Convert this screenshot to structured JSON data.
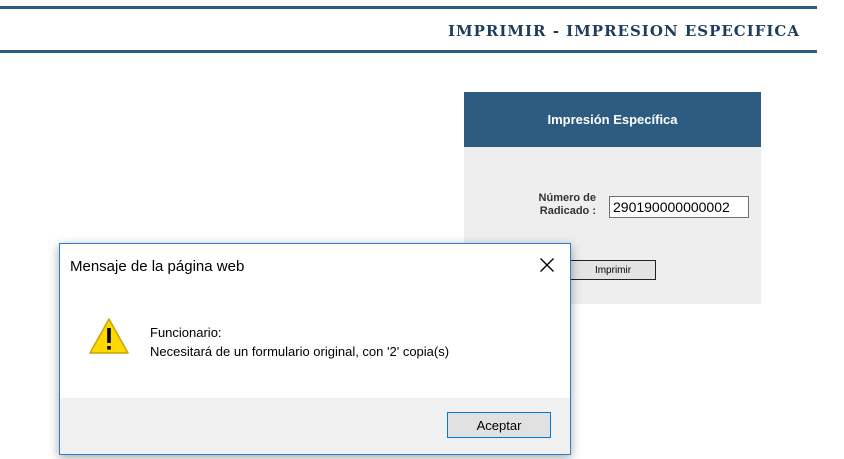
{
  "header": {
    "title": "IMPRIMIR - IMPRESION ESPECIFICA"
  },
  "panel": {
    "title": "Impresión Específica",
    "field_label_line1": "Número de",
    "field_label_line2": "Radicado :",
    "field_value": "290190000000002",
    "print_label": "Imprimir"
  },
  "dialog": {
    "title": "Mensaje de la página web",
    "close_symbol": "✕",
    "message_line1": "Funcionario:",
    "message_line2": "Necesitará de un formulario original, con '2' copia(s)",
    "accept_label": "Aceptar",
    "icon": "warning-icon"
  },
  "colors": {
    "header_blue": "#2f5b83",
    "panel_header": "#2e5c80",
    "panel_bg": "#eeeeee",
    "dialog_border": "#2b7bd1",
    "warning_yellow": "#ffd800"
  }
}
